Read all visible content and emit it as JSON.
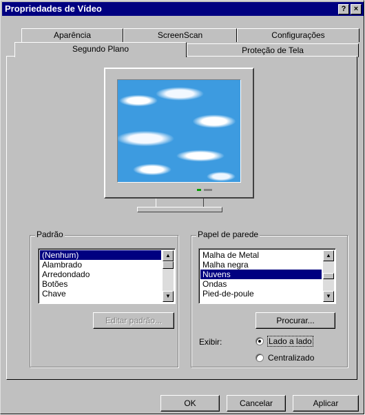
{
  "window": {
    "title": "Propriedades de Vídeo",
    "help_button": "?",
    "close_button": "×"
  },
  "tabs": {
    "row_back": [
      "Aparência",
      "ScreenScan",
      "Configurações"
    ],
    "row_front": [
      "Segundo Plano",
      "Proteção de Tela"
    ],
    "selected": "Segundo Plano"
  },
  "pattern_group": {
    "label": "Padrão",
    "items": [
      "(Nenhum)",
      "Alambrado",
      "Arredondado",
      "Botões",
      "Chave"
    ],
    "selected": "(Nenhum)",
    "edit_button": "Editar padrão..."
  },
  "wallpaper_group": {
    "label": "Papel de parede",
    "items": [
      "Malha de Metal",
      "Malha negra",
      "Nuvens",
      "Ondas",
      "Pied-de-poule"
    ],
    "selected": "Nuvens",
    "browse_button": "Procurar...",
    "display_label": "Exibir:",
    "display_options": [
      "Lado a lado",
      "Centralizado"
    ],
    "display_selected": "Lado a lado"
  },
  "buttons": {
    "ok": "OK",
    "cancel": "Cancelar",
    "apply": "Aplicar"
  },
  "colors": {
    "title_bar": "#000080",
    "selection": "#000080",
    "sky": "#3d9be0"
  }
}
